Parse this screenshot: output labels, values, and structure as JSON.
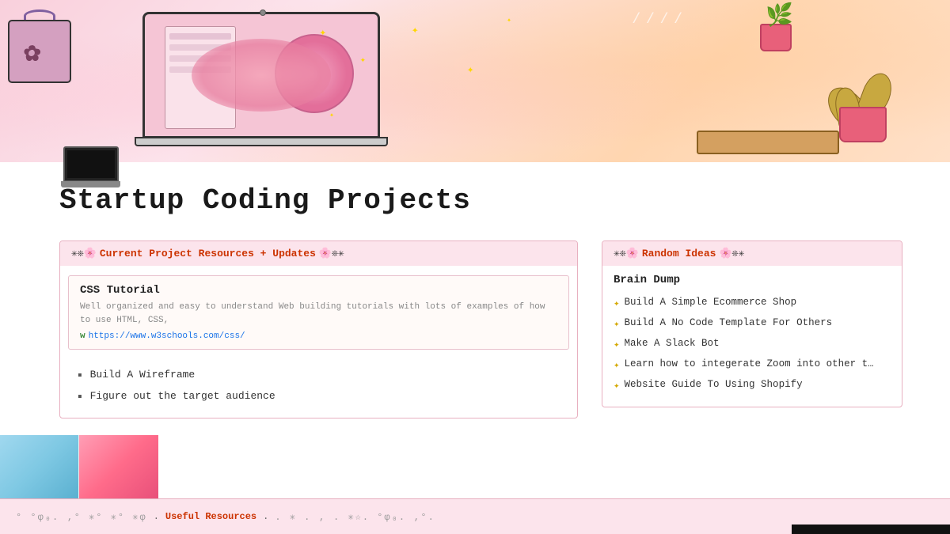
{
  "hero": {
    "alt": "Startup Coding Projects Hero Banner"
  },
  "page": {
    "title": "Startup Coding Projects"
  },
  "left_section": {
    "header_deco_left": "✳︎❊",
    "header_title": "Current Project Resources + Updates",
    "header_deco_right": "❊❊✳︎",
    "link_card": {
      "title": "CSS Tutorial",
      "description": "Well organized and easy to understand Web building tutorials with lots of examples of how to use HTML, CSS,",
      "url": "https://www.w3schools.com/css/",
      "url_prefix": "w3"
    },
    "bullets": [
      "Build A Wireframe",
      "Figure out the target audience"
    ]
  },
  "right_section": {
    "header_deco_left": "✳︎❊",
    "header_title": "Random Ideas",
    "header_deco_right": "❊❊✳︎",
    "brain_dump_label": "Brain Dump",
    "ideas": [
      "Build A Simple Ecommerce Shop",
      "Build A No Code Template For Others",
      "Make A Slack Bot",
      "Learn how to integerate Zoom into other t…",
      "Website Guide To Using Shopify"
    ]
  },
  "bottom_bar": {
    "deco_left": "° °φ₀. ‚° ✳︎° ✳︎° ✳︎φ",
    "useful_label": "Useful Resources",
    "deco_right": ". ✳︎ . ‚ . ✳︎☆. °φ₀. ‚°."
  }
}
